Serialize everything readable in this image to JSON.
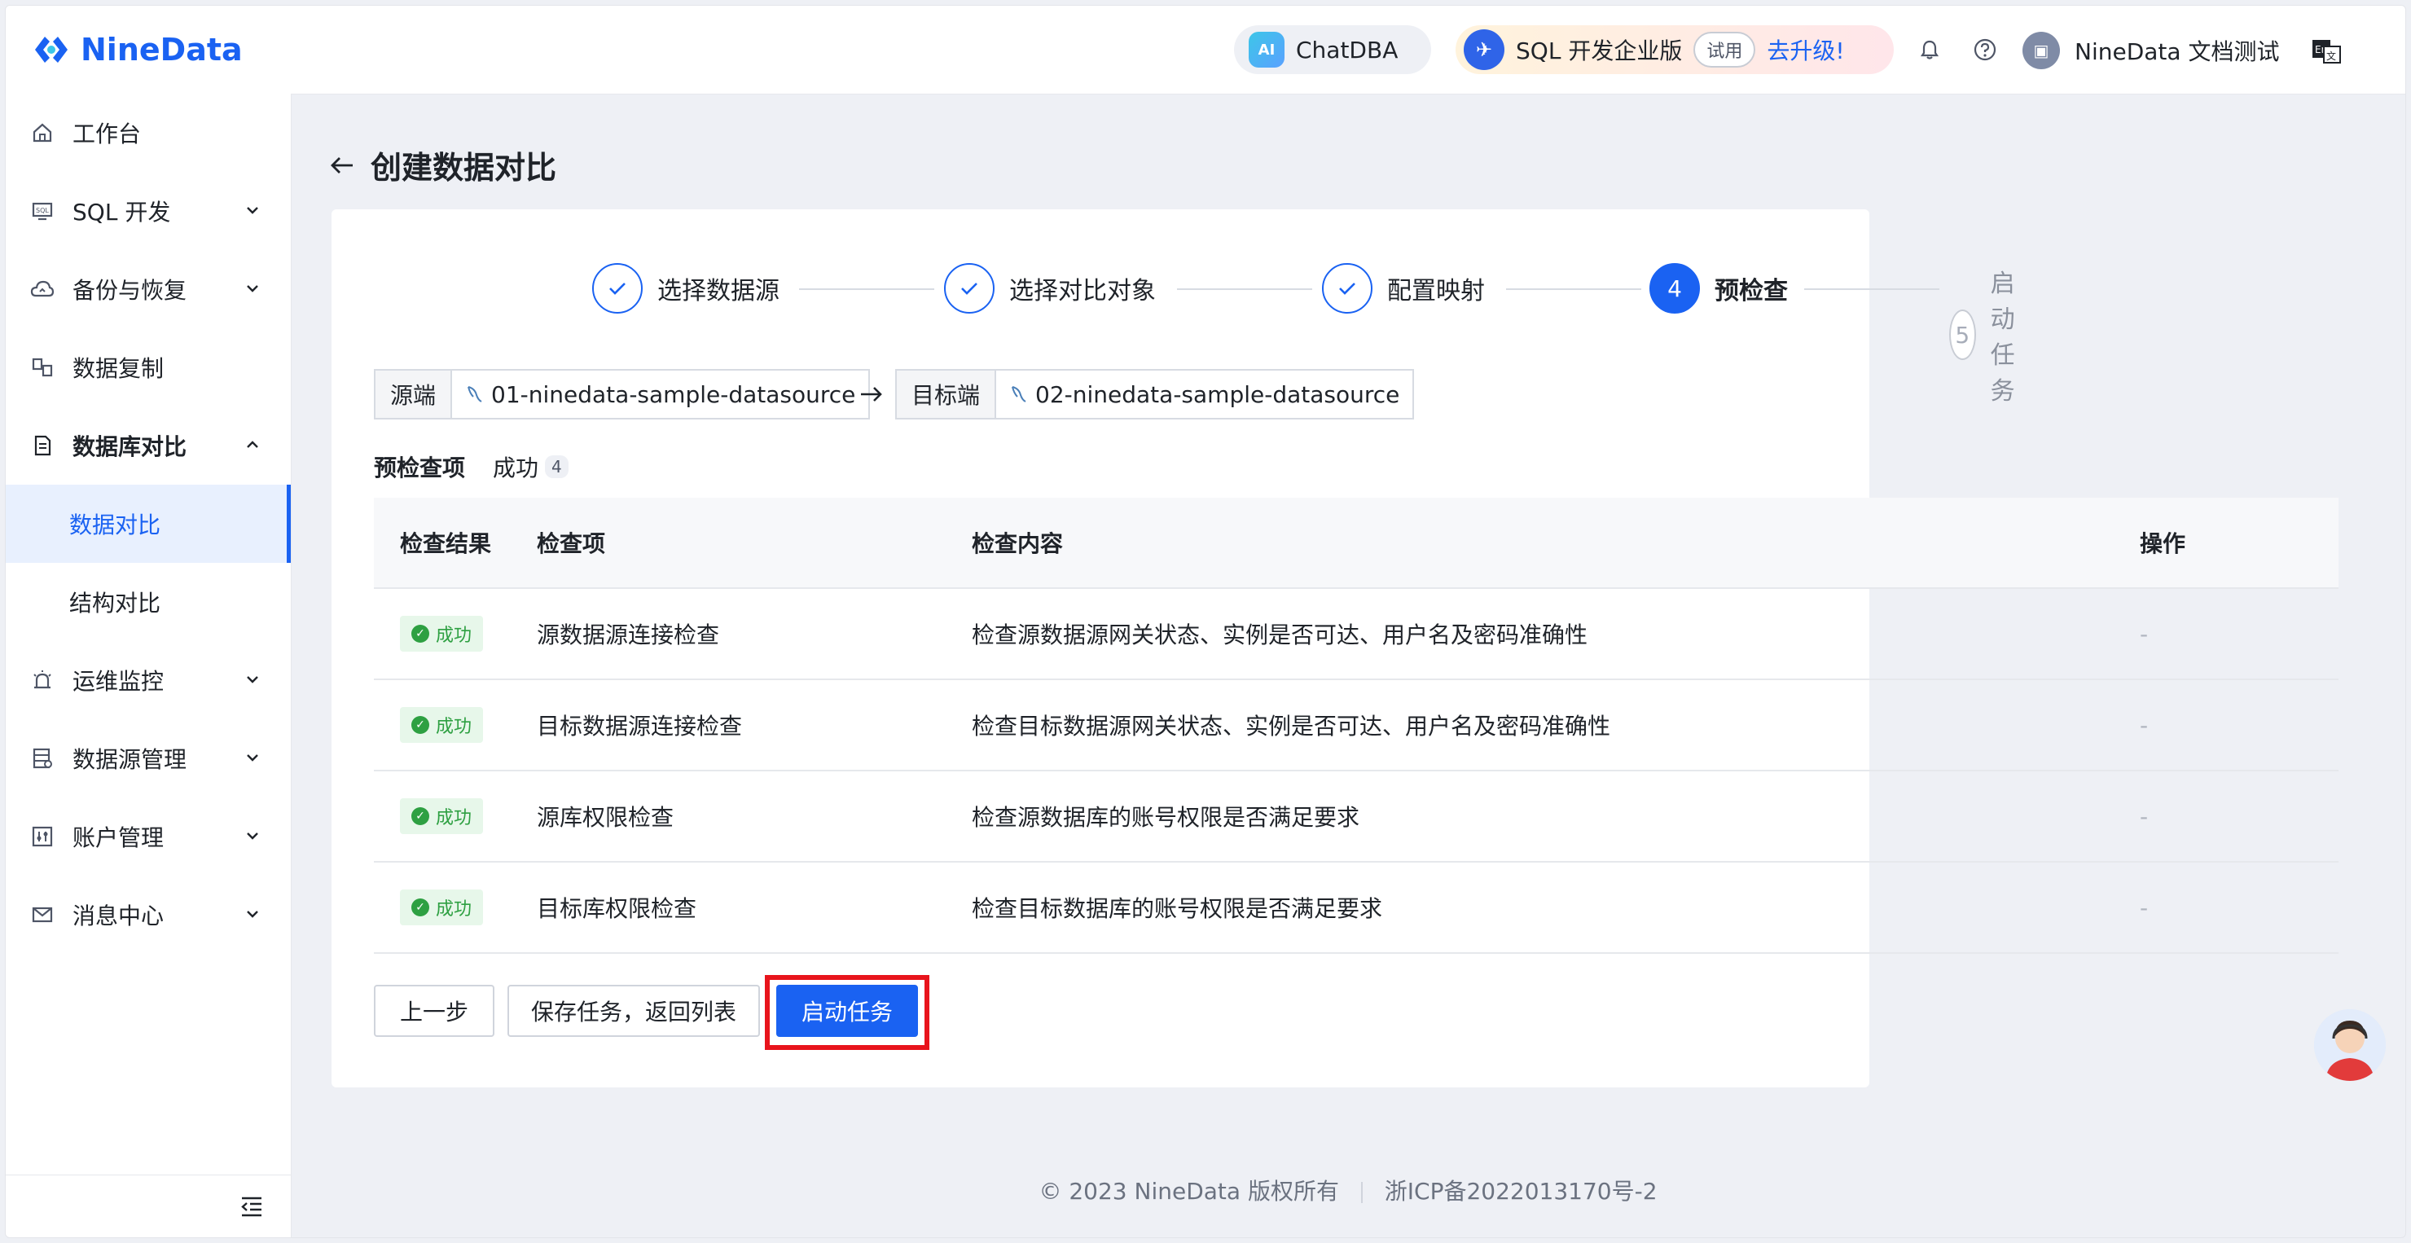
{
  "header": {
    "brand": "NineData",
    "chatdba_label": "ChatDBA",
    "ai_badge": "AI",
    "edition_label": "SQL 开发企业版",
    "trial_label": "试用",
    "upgrade_label": "去升级!",
    "user_name": "NineData 文档测试"
  },
  "sidebar": {
    "items": [
      {
        "label": "工作台"
      },
      {
        "label": "SQL 开发"
      },
      {
        "label": "备份与恢复"
      },
      {
        "label": "数据复制"
      },
      {
        "label": "数据库对比"
      },
      {
        "label": "数据对比"
      },
      {
        "label": "结构对比"
      },
      {
        "label": "运维监控"
      },
      {
        "label": "数据源管理"
      },
      {
        "label": "账户管理"
      },
      {
        "label": "消息中心"
      }
    ]
  },
  "page": {
    "title": "创建数据对比"
  },
  "steps": [
    {
      "label": "选择数据源",
      "state": "done"
    },
    {
      "label": "选择对比对象",
      "state": "done"
    },
    {
      "label": "配置映射",
      "state": "done"
    },
    {
      "label": "预检查",
      "number": "4",
      "state": "current"
    },
    {
      "label": "启动任务",
      "number": "5",
      "state": "pending"
    }
  ],
  "source": {
    "tag": "源端",
    "name": "01-ninedata-sample-datasource"
  },
  "target": {
    "tag": "目标端",
    "name": "02-ninedata-sample-datasource"
  },
  "summary": {
    "label": "预检查项",
    "success_label": "成功",
    "success_count": "4"
  },
  "table": {
    "headers": [
      "检查结果",
      "检查项",
      "检查内容",
      "操作"
    ],
    "rows": [
      {
        "result": "成功",
        "item": "源数据源连接检查",
        "content": "检查源数据源网关状态、实例是否可达、用户名及密码准确性",
        "action": "-"
      },
      {
        "result": "成功",
        "item": "目标数据源连接检查",
        "content": "检查目标数据源网关状态、实例是否可达、用户名及密码准确性",
        "action": "-"
      },
      {
        "result": "成功",
        "item": "源库权限检查",
        "content": "检查源数据库的账号权限是否满足要求",
        "action": "-"
      },
      {
        "result": "成功",
        "item": "目标库权限检查",
        "content": "检查目标数据库的账号权限是否满足要求",
        "action": "-"
      }
    ]
  },
  "buttons": {
    "prev": "上一步",
    "save": "保存任务，返回列表",
    "start": "启动任务"
  },
  "footer": {
    "copyright": "© 2023 NineData 版权所有",
    "icp": "浙ICP备2022013170号-2"
  },
  "colors": {
    "accent": "#1a62f2",
    "success": "#2ea042",
    "highlight": "#e8141c"
  }
}
